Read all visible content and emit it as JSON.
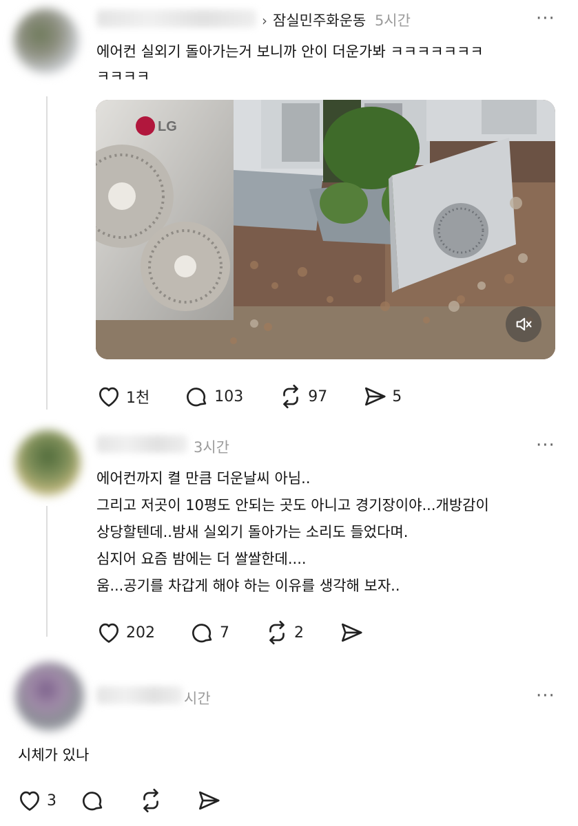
{
  "posts": [
    {
      "community": "잠실민주화운동",
      "time": "5시간",
      "text_lines": [
        "에어컨 실외기 돌아가는거 보니까 안이 더운가봐 ㅋㅋㅋㅋㅋㅋㅋ",
        "ㅋㅋㅋㅋ"
      ],
      "media": {
        "brand": "LG",
        "muted": true
      },
      "stats": {
        "likes": "1천",
        "replies": "103",
        "reposts": "97",
        "shares": "5"
      }
    },
    {
      "time": "3시간",
      "text_lines": [
        "에어컨까지 켤 만큼 더운날씨 아님..",
        "그리고 저곳이 10평도 안되는 곳도 아니고 경기장이야...개방감이",
        "상당할텐데..밤새 실외기 돌아가는 소리도 들었다며.",
        "심지어 요즘 밤에는 더 쌀쌀한데....",
        "움...공기를 차갑게 해야 하는 이유를 생각해 보자.."
      ],
      "stats": {
        "likes": "202",
        "replies": "7",
        "reposts": "2"
      }
    },
    {
      "time": "시간",
      "text_lines": [
        "시체가 있나"
      ],
      "stats": {
        "likes": "3"
      }
    }
  ],
  "icons": {
    "more": "more-dots-icon",
    "like": "heart-icon",
    "reply": "speech-bubble-icon",
    "repost": "repost-arrows-icon",
    "share": "send-arrow-icon",
    "mute": "speaker-muted-icon"
  },
  "colors": {
    "text": "#111111",
    "meta": "#9b9b9b",
    "icon": "#222222",
    "divider": "#dddddd"
  }
}
